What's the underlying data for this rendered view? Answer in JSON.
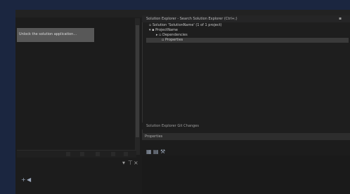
{
  "window": {
    "title": "",
    "accent": "#007acc",
    "desktop_color": "#1b2640"
  },
  "notice": {
    "text": "Unlock the solution application..."
  },
  "left_panel": {
    "mini_tabs": [
      "",
      "",
      "",
      "",
      "",
      "",
      ""
    ]
  },
  "solution_explorer": {
    "title": "Solution Explorer - Search Solution Explorer (Ctrl+;)",
    "items": [
      {
        "label": "Solution 'SolutionName' (1 of 1 project)",
        "icon": "solution-icon",
        "selected": false
      },
      {
        "label": "ProjectName",
        "icon": "project-icon",
        "selected": false
      },
      {
        "label": "Dependencies",
        "icon": "folder-icon",
        "selected": false
      },
      {
        "label": "Properties",
        "icon": "file-icon",
        "selected": true
      }
    ]
  },
  "status": {
    "text": "Solution Explorer  Git Changes"
  },
  "properties": {
    "title": "Properties"
  }
}
